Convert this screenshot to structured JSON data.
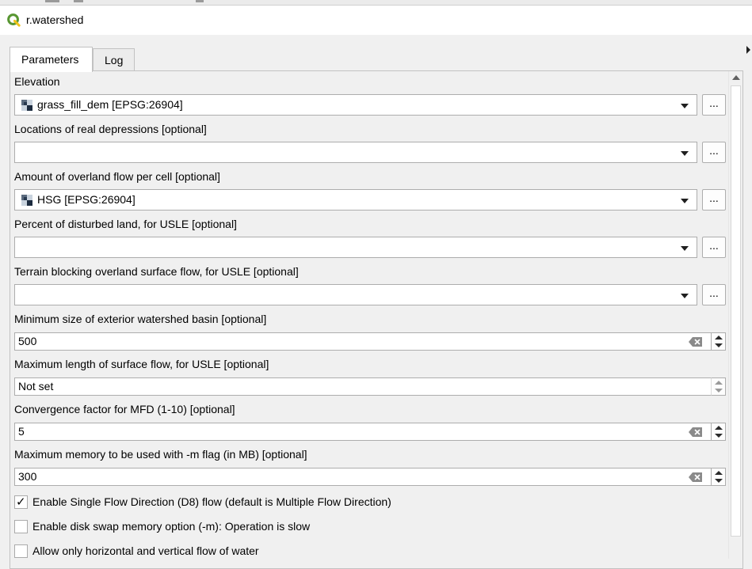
{
  "window": {
    "title": "r.watershed",
    "icon": "qgis-logo-icon"
  },
  "tabs": [
    {
      "label": "Parameters",
      "active": true
    },
    {
      "label": "Log",
      "active": false
    }
  ],
  "params": {
    "elevation": {
      "label": "Elevation",
      "value": "grass_fill_dem [EPSG:26904]",
      "icon": "raster-layer-icon"
    },
    "depressions": {
      "label": "Locations of real depressions [optional]",
      "value": ""
    },
    "flow": {
      "label": "Amount of overland flow per cell [optional]",
      "value": "HSG [EPSG:26904]",
      "icon": "raster-layer-icon"
    },
    "disturbed": {
      "label": "Percent of disturbed land, for USLE [optional]",
      "value": ""
    },
    "blocking": {
      "label": "Terrain blocking overland surface flow, for USLE [optional]",
      "value": ""
    },
    "threshold": {
      "label": "Minimum size of exterior watershed basin [optional]",
      "value": "500"
    },
    "max_slope_length": {
      "label": "Maximum length of surface flow, for USLE [optional]",
      "value": "Not set"
    },
    "convergence": {
      "label": "Convergence factor for MFD (1-10) [optional]",
      "value": "5"
    },
    "memory": {
      "label": "Maximum memory to be used with -m flag (in MB) [optional]",
      "value": "300"
    }
  },
  "browse_label": "...",
  "checkboxes": [
    {
      "label": "Enable Single Flow Direction (D8) flow (default is Multiple Flow Direction)",
      "checked": true
    },
    {
      "label": "Enable disk swap memory option (-m): Operation is slow",
      "checked": false
    },
    {
      "label": "Allow only horizontal and vertical flow of water",
      "checked": false
    }
  ],
  "check_glyph": "✓",
  "colors": {
    "qgis_green": "#589632",
    "qgis_yellow": "#ee7913"
  }
}
